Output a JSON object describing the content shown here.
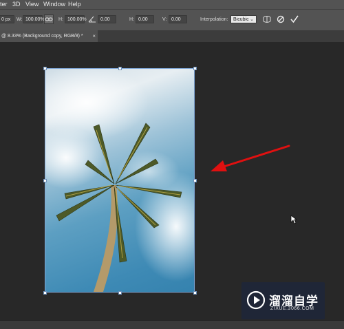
{
  "menu": [
    "ter",
    "3D",
    "View",
    "Window",
    "Help"
  ],
  "options": {
    "x_value": "0 px",
    "w_label": "W:",
    "w_value": "100.00%",
    "h_label": "H:",
    "h_value": "100.00%",
    "angle_value": "0.00",
    "hskew_label": "H:",
    "hskew_value": "0.00",
    "vskew_label": "V:",
    "vskew_value": "0.00",
    "interp_label": "Interpolation:",
    "interp_value": "Bicubic"
  },
  "document_tab": {
    "label": "@ 8.33% (Background copy, RGB/8) *",
    "close": "×"
  },
  "watermark": {
    "title": "溜溜自学",
    "url": "ZIXUE.3066.COM"
  },
  "colors": {
    "arrow": "#e01010",
    "selection": "#7fa6d6",
    "sky": "#4a90ba"
  }
}
